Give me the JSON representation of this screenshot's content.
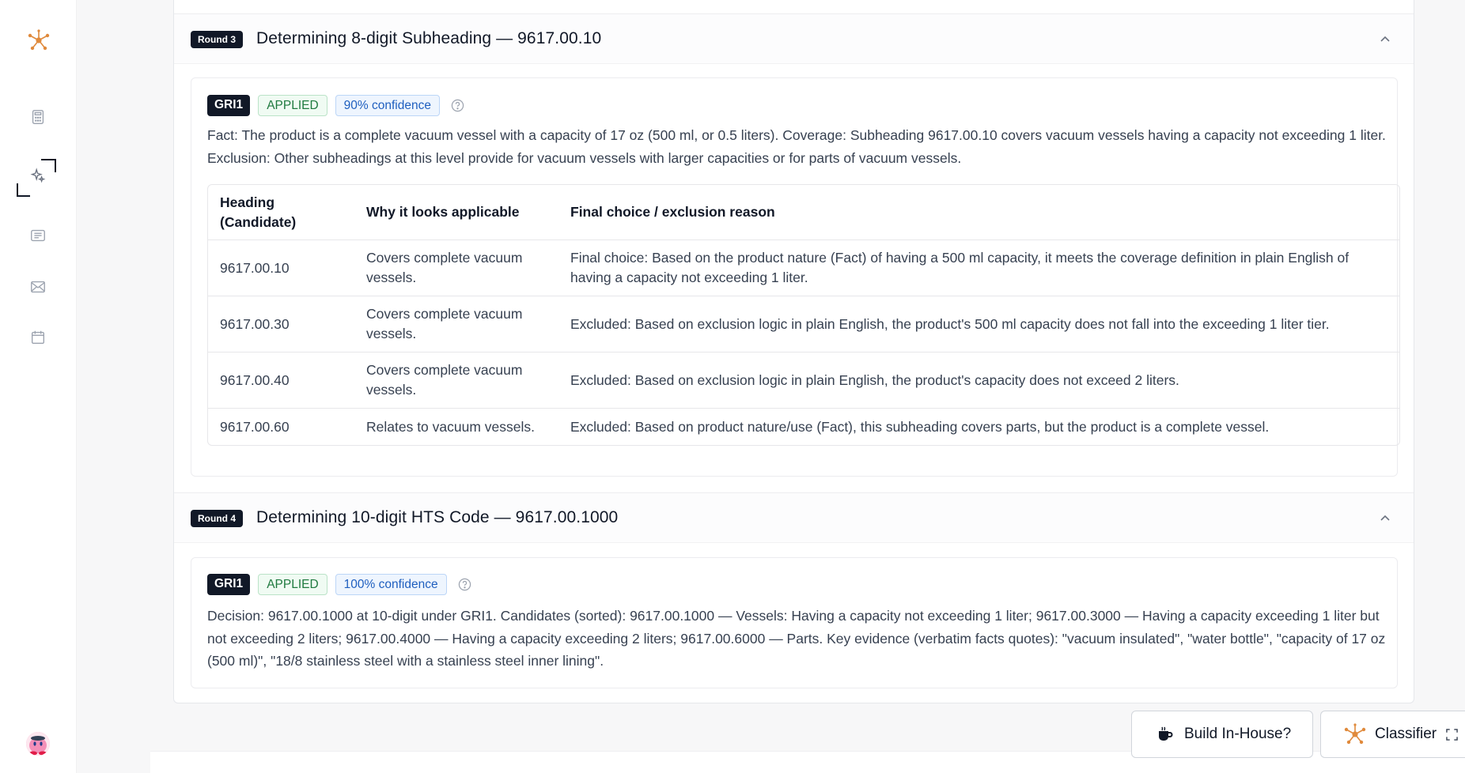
{
  "sidebar": {
    "icons": [
      "network-logo-icon",
      "calculator-icon",
      "sparkle-icon",
      "list-icon",
      "mail-icon",
      "calendar-icon"
    ],
    "avatar": "avatar"
  },
  "rounds": [
    {
      "badge": "Round 3",
      "title": "Determining 8-digit Subheading — 9617.00.10",
      "tags": {
        "gri": "GRI1",
        "status": "APPLIED",
        "confidence": "90% confidence"
      },
      "text": "Fact: The product is a complete vacuum vessel with a capacity of 17 oz (500 ml, or 0.5 liters). Coverage: Subheading 9617.00.10 covers vacuum vessels having a capacity not exceeding 1 liter. Exclusion: Other subheadings at this level provide for vacuum vessels with larger capacities or for parts of vacuum vessels.",
      "table": {
        "headers": [
          "Heading (Candidate)",
          "Why it looks applicable",
          "Final choice / exclusion reason"
        ],
        "rows": [
          [
            "9617.00.10",
            "Covers complete vacuum vessels.",
            "Final choice: Based on the product nature (Fact) of having a 500 ml capacity, it meets the coverage definition in plain English of having a capacity not exceeding 1 liter."
          ],
          [
            "9617.00.30",
            "Covers complete vacuum vessels.",
            "Excluded: Based on exclusion logic in plain English, the product's 500 ml capacity does not fall into the exceeding 1 liter tier."
          ],
          [
            "9617.00.40",
            "Covers complete vacuum vessels.",
            "Excluded: Based on exclusion logic in plain English, the product's capacity does not exceed 2 liters."
          ],
          [
            "9617.00.60",
            "Relates to vacuum vessels.",
            "Excluded: Based on product nature/use (Fact), this subheading covers parts, but the product is a complete vessel."
          ]
        ]
      }
    },
    {
      "badge": "Round 4",
      "title": "Determining 10-digit HTS Code — 9617.00.1000",
      "tags": {
        "gri": "GRI1",
        "status": "APPLIED",
        "confidence": "100% confidence"
      },
      "text": "Decision: 9617.00.1000 at 10-digit under GRI1. Candidates (sorted): 9617.00.1000 — Vessels: Having a capacity not exceeding 1 liter; 9617.00.3000 — Having a capacity exceeding 1 liter but not exceeding 2 liters; 9617.00.4000 — Having a capacity exceeding 2 liters; 9617.00.6000 — Parts. Key evidence (verbatim facts quotes): \"vacuum insulated\", \"water bottle\", \"capacity of 17 oz (500 ml)\", \"18/8 stainless steel with a stainless steel inner lining\"."
    }
  ],
  "floating": {
    "build_label": "Build In-House?",
    "classifier_label": "Classifier"
  },
  "colors": {
    "accent": "#e08a3c",
    "badge_dark": "#111827",
    "applied_green": "#1f7a3f",
    "confidence_blue": "#1f5fbf"
  }
}
